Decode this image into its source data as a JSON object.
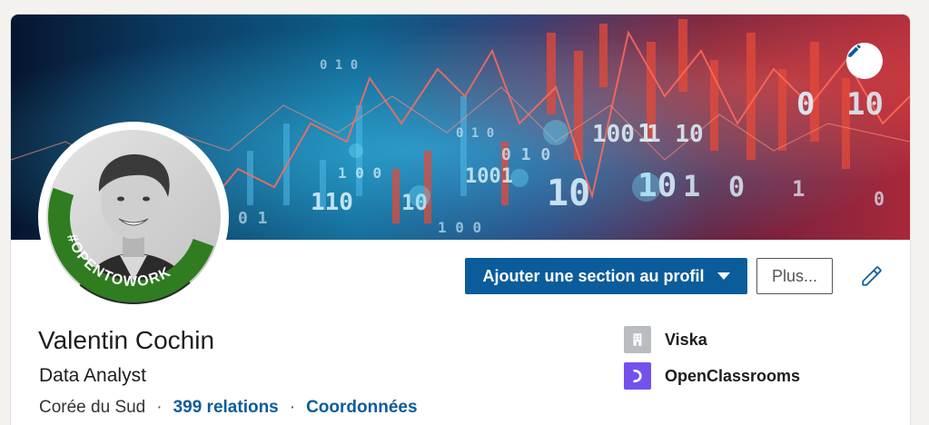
{
  "profile": {
    "name": "Valentin Cochin",
    "headline": "Data Analyst",
    "location": "Corée du Sud",
    "separator": "·",
    "connections": "399 relations",
    "contact_info": "Coordonnées",
    "open_to_work_badge": "#OPENTOWORK"
  },
  "actions": {
    "add_section_label": "Ajouter une section au profil",
    "more_label": "Plus..."
  },
  "companies": [
    {
      "name": "Viska",
      "icon": "building-icon"
    },
    {
      "name": "OpenClassrooms",
      "icon": "openclassrooms-logo-icon"
    }
  ],
  "colors": {
    "primary_button": "#0b5c9b",
    "link": "#0b5c9b",
    "open_to_work_green": "#2f7d20",
    "openclassrooms_purple": "#7451eb",
    "company_placeholder_grey": "#b9bcc0"
  },
  "icons": {
    "banner_edit": "pencil-icon",
    "profile_edit": "pencil-icon",
    "dropdown": "caret-down-icon"
  }
}
